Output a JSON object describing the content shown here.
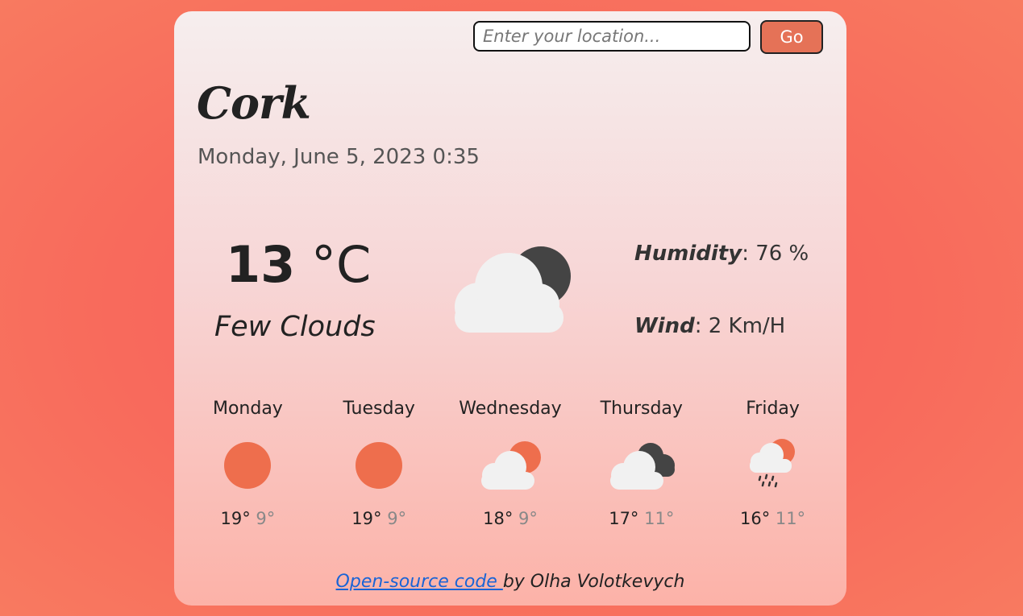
{
  "search": {
    "placeholder": "Enter your location...",
    "button": "Go"
  },
  "current": {
    "city": "Cork",
    "datetime": "Monday, June 5, 2023 0:35",
    "temperature": "13",
    "unit": "°C",
    "description": "Few Clouds",
    "humidity_label": "Humidity",
    "humidity_value": ": 76 %",
    "wind_label": "Wind",
    "wind_value": ": 2 Km/H",
    "icon": "few-clouds-night-icon"
  },
  "forecast": [
    {
      "day": "Monday",
      "max": "19°",
      "min": "9°",
      "icon": "sun-icon"
    },
    {
      "day": "Tuesday",
      "max": "19°",
      "min": "9°",
      "icon": "sun-icon"
    },
    {
      "day": "Wednesday",
      "max": "18°",
      "min": "9°",
      "icon": "few-clouds-icon"
    },
    {
      "day": "Thursday",
      "max": "17°",
      "min": "11°",
      "icon": "broken-clouds-icon"
    },
    {
      "day": "Friday",
      "max": "16°",
      "min": "11°",
      "icon": "rain-icon"
    }
  ],
  "footer": {
    "link_text": "Open-source code ",
    "author": "by Olha Volotkevych"
  },
  "colors": {
    "accent": "#e57257",
    "sun": "#ee6e4d",
    "link": "#1a64d6"
  }
}
